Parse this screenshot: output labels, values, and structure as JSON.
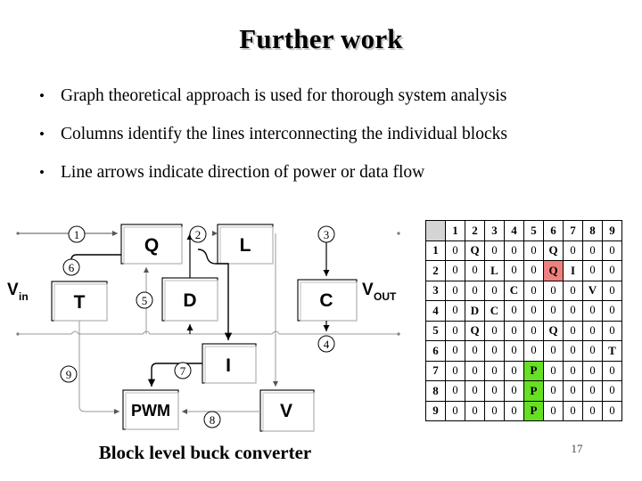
{
  "slide": {
    "title": "Further work",
    "page_number": "17"
  },
  "bullets": {
    "marker": "•",
    "items": [
      "Graph theoretical approach is used for thorough system analysis",
      "Columns identify the lines interconnecting the individual blocks",
      "Line arrows indicate direction of power or data flow"
    ]
  },
  "diagram": {
    "caption": "Block level buck converter",
    "input_label": "V",
    "input_sub": "in",
    "output_label": "V",
    "output_sub": "OUT",
    "blocks": [
      {
        "id": "Q",
        "label": "Q"
      },
      {
        "id": "L",
        "label": "L"
      },
      {
        "id": "T",
        "label": "T"
      },
      {
        "id": "D",
        "label": "D"
      },
      {
        "id": "C",
        "label": "C"
      },
      {
        "id": "I",
        "label": "I"
      },
      {
        "id": "PWM",
        "label": "PWM"
      },
      {
        "id": "V",
        "label": "V"
      }
    ],
    "line_numbers": [
      "1",
      "2",
      "3",
      "4",
      "5",
      "6",
      "7",
      "8",
      "9"
    ]
  },
  "matrix": {
    "corner": "",
    "columns": [
      "1",
      "2",
      "3",
      "4",
      "5",
      "6",
      "7",
      "8",
      "9"
    ],
    "rows": [
      {
        "label": "1",
        "cells": [
          "0",
          "Q",
          "0",
          "0",
          "0",
          "Q",
          "0",
          "0",
          "0"
        ]
      },
      {
        "label": "2",
        "cells": [
          "0",
          "0",
          "L",
          "0",
          "0",
          "Q",
          "I",
          "0",
          "0"
        ]
      },
      {
        "label": "3",
        "cells": [
          "0",
          "0",
          "0",
          "C",
          "0",
          "0",
          "0",
          "V",
          "0"
        ]
      },
      {
        "label": "4",
        "cells": [
          "0",
          "D",
          "C",
          "0",
          "0",
          "0",
          "0",
          "0",
          "0"
        ]
      },
      {
        "label": "5",
        "cells": [
          "0",
          "Q",
          "0",
          "0",
          "0",
          "Q",
          "0",
          "0",
          "0"
        ]
      },
      {
        "label": "6",
        "cells": [
          "0",
          "0",
          "0",
          "0",
          "0",
          "0",
          "0",
          "0",
          "T"
        ]
      },
      {
        "label": "7",
        "cells": [
          "0",
          "0",
          "0",
          "0",
          "P",
          "0",
          "0",
          "0",
          "0"
        ]
      },
      {
        "label": "8",
        "cells": [
          "0",
          "0",
          "0",
          "0",
          "P",
          "0",
          "0",
          "0",
          "0"
        ]
      },
      {
        "label": "9",
        "cells": [
          "0",
          "0",
          "0",
          "0",
          "P",
          "0",
          "0",
          "0",
          "0"
        ]
      }
    ],
    "highlights": {
      "red": [
        {
          "row": 2,
          "col": 6
        }
      ],
      "green": [
        {
          "row": 7,
          "col": 5
        },
        {
          "row": 8,
          "col": 5
        },
        {
          "row": 9,
          "col": 5
        }
      ]
    },
    "colors": {
      "red": "#f08080",
      "green": "#66e022",
      "corner_gray": "#d4d4d4"
    }
  }
}
